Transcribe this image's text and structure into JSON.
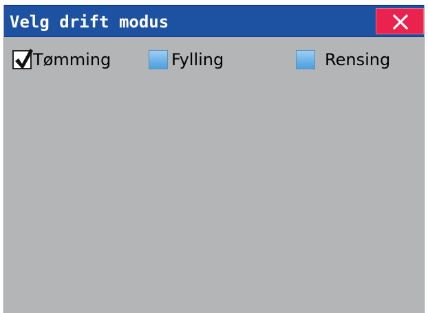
{
  "window": {
    "title": "Velg drift modus",
    "close_icon": "close-x-icon"
  },
  "options": [
    {
      "label": "Tømming",
      "checked": true
    },
    {
      "label": "Fylling",
      "checked": false
    },
    {
      "label": "Rensing",
      "checked": false
    }
  ],
  "colors": {
    "titlebar": "#1d51a1",
    "close_button": "#e9234e",
    "panel": "#b3b5b6",
    "checkbox_unchecked": "#6cb4e8"
  }
}
